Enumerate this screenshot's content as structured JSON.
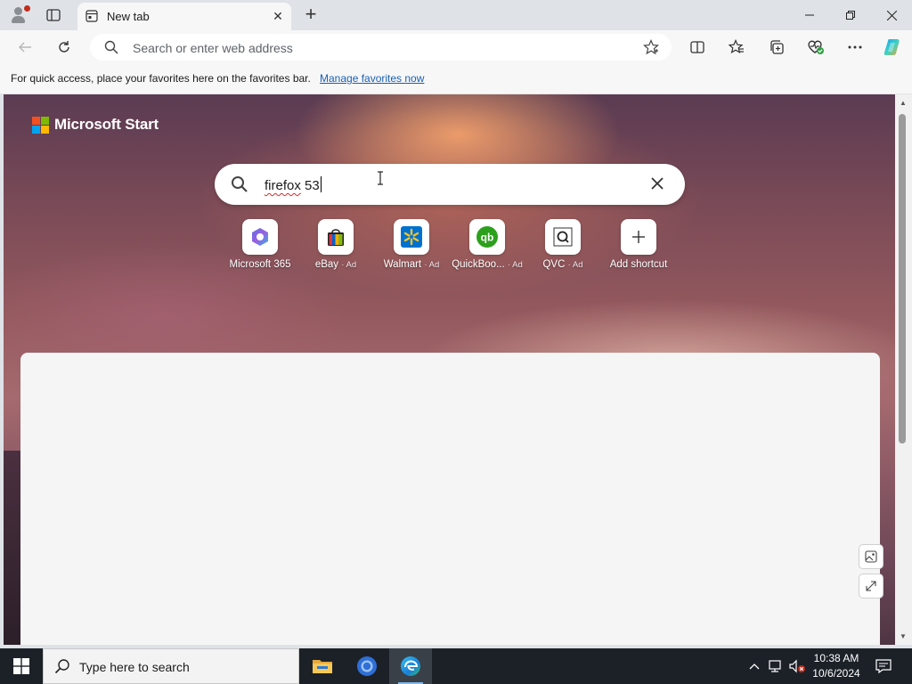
{
  "browser": {
    "tab_title": "New tab",
    "address_placeholder": "Search or enter web address"
  },
  "favorites_bar": {
    "message": "For quick access, place your favorites here on the favorites bar.",
    "link": "Manage favorites now"
  },
  "page": {
    "brand": "Microsoft Start",
    "search_query_misspelled": "firefox",
    "search_query_rest": " 53",
    "shortcuts": [
      {
        "label": "Microsoft 365",
        "ad": ""
      },
      {
        "label": "eBay",
        "ad": "· Ad"
      },
      {
        "label": "Walmart",
        "ad": "· Ad"
      },
      {
        "label": "QuickBoo...",
        "ad": "· Ad"
      },
      {
        "label": "QVC",
        "ad": "· Ad"
      },
      {
        "label": "Add shortcut",
        "ad": ""
      }
    ]
  },
  "taskbar": {
    "search_placeholder": "Type here to search",
    "time": "10:38 AM",
    "date": "10/6/2024"
  },
  "colors": {
    "accent": "#1a5fb4",
    "taskbar": "#1c2128",
    "ms_red": "#f25022",
    "ms_green": "#7fba00",
    "ms_blue": "#00a4ef",
    "ms_yellow": "#ffb900"
  }
}
